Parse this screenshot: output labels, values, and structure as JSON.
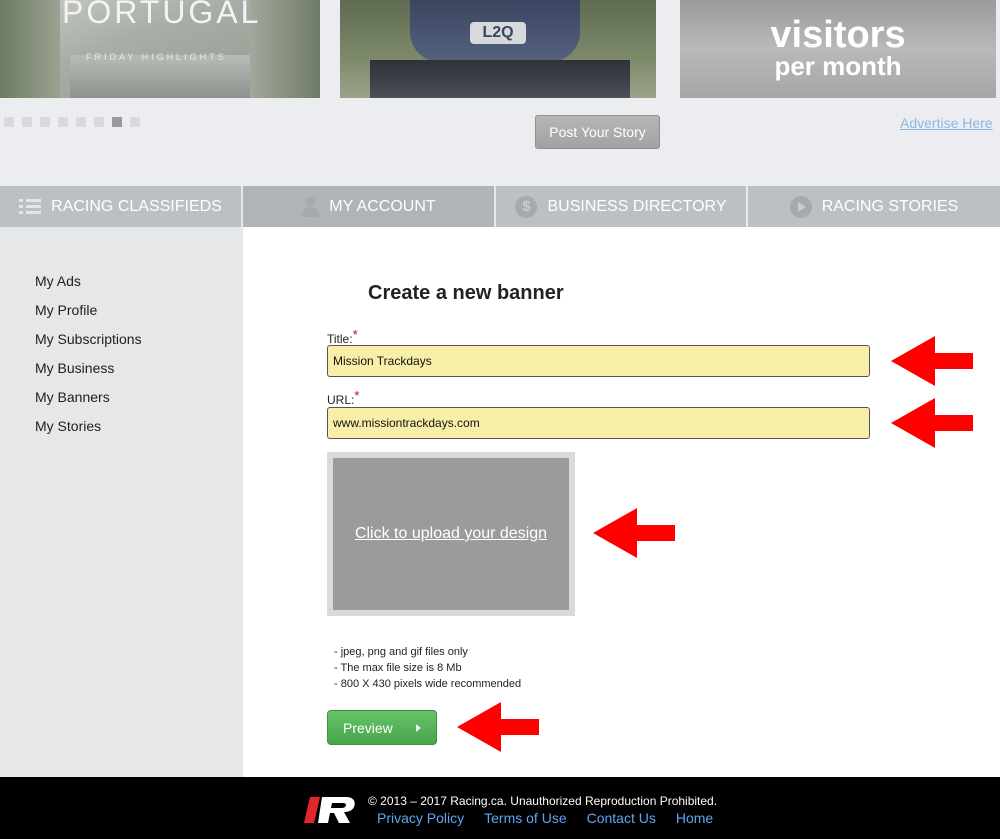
{
  "carousel": {
    "slides": [
      {
        "title": "PORTUGAL",
        "subtitle": "FRIDAY HIGHLIGHTS"
      },
      {
        "plate": "L2Q"
      },
      {
        "line1": "visitors",
        "line2": "per month"
      }
    ],
    "dot_count": 8,
    "active_dot": 6
  },
  "header": {
    "post_story": "Post Your Story",
    "advertise": "Advertise Here"
  },
  "nav": [
    {
      "label": "RACING CLASSIFIEDS",
      "icon": "list-icon"
    },
    {
      "label": "MY ACCOUNT",
      "icon": "user-icon"
    },
    {
      "label": "BUSINESS DIRECTORY",
      "icon": "dollar-icon",
      "glyph": "$"
    },
    {
      "label": "RACING STORIES",
      "icon": "play-icon"
    }
  ],
  "sidebar": {
    "items": [
      "My Ads",
      "My Profile",
      "My Subscriptions",
      "My Business",
      "My Banners",
      "My Stories"
    ]
  },
  "form": {
    "heading": "Create a new banner",
    "title_label": "Title:",
    "title_value": "Mission Trackdays",
    "url_label": "URL:",
    "url_value": "www.missiontrackdays.com",
    "required_mark": "*",
    "upload_text": "Click to upload your design",
    "notes": [
      "- jpeg, png and gif files only",
      "- The max file size is 8 Mb",
      "- 800 X 430 pixels wide recommended"
    ],
    "preview": "Preview"
  },
  "footer": {
    "copyright": "© 2013 – 2017 Racing.ca. Unauthorized Reproduction Prohibited.",
    "links": [
      "Privacy Policy",
      "Terms of Use",
      "Contact Us",
      "Home"
    ]
  },
  "colors": {
    "field_bg": "#f7efa8",
    "preview_green": "#4fae52",
    "annotation_arrow": "#ff0000",
    "link_blue": "#5ea5ef"
  }
}
